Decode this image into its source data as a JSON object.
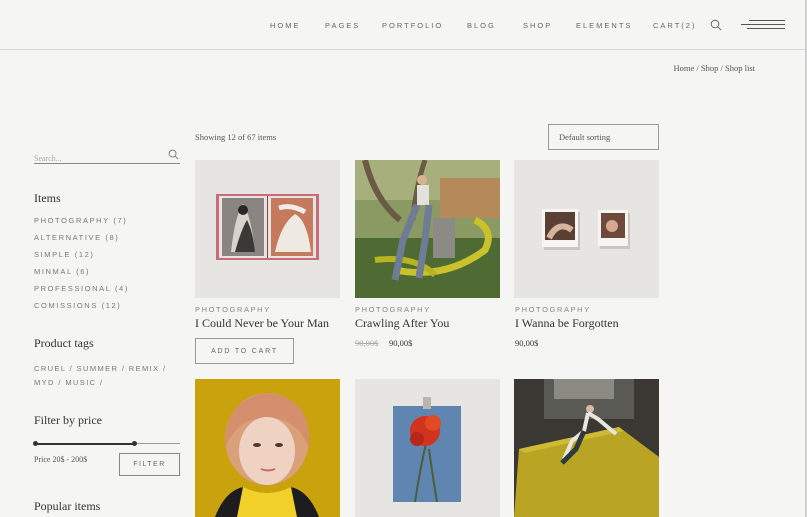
{
  "nav": {
    "items": [
      {
        "label": "HOME"
      },
      {
        "label": "PAGES"
      },
      {
        "label": "PORTFOLIO"
      },
      {
        "label": "BLOG"
      },
      {
        "label": "SHOP"
      },
      {
        "label": "ELEMENTS"
      },
      {
        "label": "CART(2)"
      }
    ]
  },
  "breadcrumb": {
    "home": "Home",
    "sep1": " / ",
    "shop": "Shop",
    "sep2": " / ",
    "current": "Shop list"
  },
  "sidebar": {
    "search_placeholder": "Search...",
    "items_title": "Items",
    "categories": [
      {
        "label": "PHOTOGRAPHY (7)"
      },
      {
        "label": "ALTERNATIVE (8)"
      },
      {
        "label": "SIMPLE (12)"
      },
      {
        "label": "MINMAL (6)"
      },
      {
        "label": "PROFESSIONAL (4)"
      },
      {
        "label": "COMISSIONS (12)"
      }
    ],
    "tags_title": "Product tags",
    "tags": [
      "CRUEL",
      "SUMMER",
      "REMIX",
      "MYD",
      "MUSIC"
    ],
    "tag_sep": " / ",
    "price_title": "Filter by price",
    "price_label": "Price 20$ - 200$",
    "price_range": {
      "min_fraction": 0.0,
      "max_fraction": 0.69
    },
    "filter_label": "FILTER",
    "popular_title": "Popular items"
  },
  "main": {
    "results_text": "Showing 12 of 67 items",
    "sort_value": "Default sorting",
    "products": [
      {
        "category": "PHOTOGRAPHY",
        "title": "I Could Never be Your Man",
        "button": "ADD TO CART"
      },
      {
        "category": "PHOTOGRAPHY",
        "title": "Crawling After You",
        "old_price": "90,00$",
        "price": "90,00$"
      },
      {
        "category": "PHOTOGRAPHY",
        "title": "I Wanna be Forgotten",
        "price": "90,00$"
      }
    ]
  },
  "colors": {
    "background": "#f5f5f3",
    "text": "#333333",
    "muted": "#777777",
    "image_bg": "#e6e5e2",
    "yellow": "#c9a20e"
  }
}
